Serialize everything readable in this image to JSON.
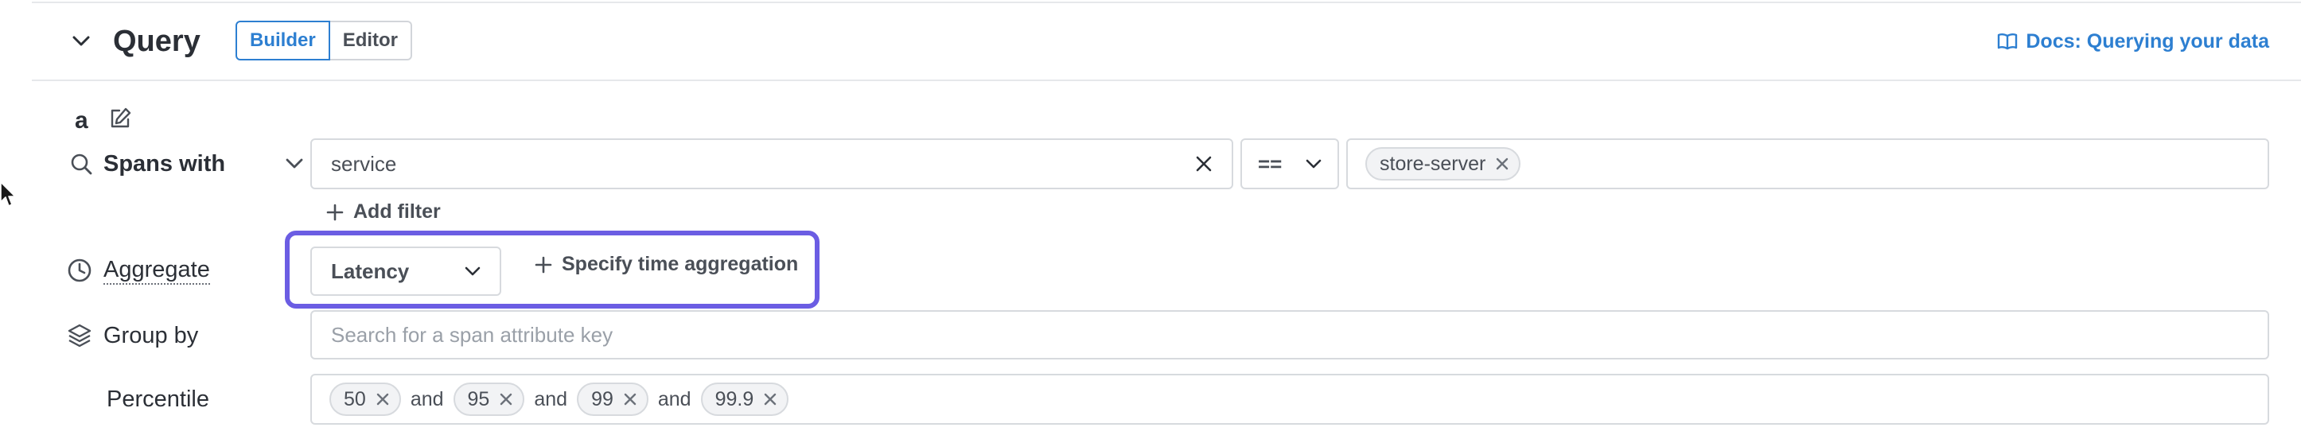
{
  "header": {
    "title": "Query",
    "tabs": [
      {
        "label": "Builder",
        "active": true
      },
      {
        "label": "Editor",
        "active": false
      }
    ],
    "docs_link": "Docs: Querying your data"
  },
  "query": {
    "name": "a",
    "spans_with_label": "Spans with",
    "filter": {
      "attribute": "service",
      "operator": "==",
      "values": [
        "store-server"
      ]
    },
    "add_filter_label": "Add filter",
    "aggregate": {
      "label": "Aggregate",
      "function": "Latency",
      "time_aggregation_label": "Specify time aggregation"
    },
    "group_by": {
      "label": "Group by",
      "placeholder": "Search for a span attribute key"
    },
    "percentile": {
      "label": "Percentile",
      "values": [
        "50",
        "95",
        "99",
        "99.9"
      ],
      "joiner": "and"
    }
  },
  "colors": {
    "accent": "#2d7fd1",
    "highlight": "#6b5de3",
    "border": "#d7dade"
  }
}
